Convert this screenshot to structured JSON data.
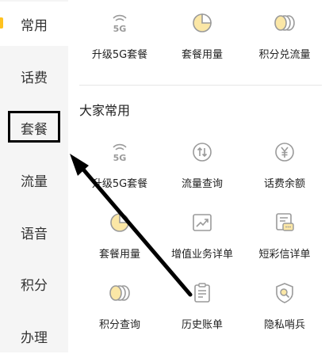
{
  "sidebar": {
    "items": [
      {
        "label": "常用"
      },
      {
        "label": "话费"
      },
      {
        "label": "套餐"
      },
      {
        "label": "流量"
      },
      {
        "label": "语音"
      },
      {
        "label": "积分"
      },
      {
        "label": "办理"
      }
    ]
  },
  "top_row": {
    "items": [
      {
        "label": "升级5G套餐",
        "icon": "5g-icon"
      },
      {
        "label": "套餐用量",
        "icon": "pie-chart-icon"
      },
      {
        "label": "积分兑流量",
        "icon": "coins-icon"
      }
    ]
  },
  "section": {
    "title": "大家常用",
    "items": [
      {
        "label": "升级5G套餐",
        "icon": "5g-icon"
      },
      {
        "label": "流量查询",
        "icon": "data-transfer-icon"
      },
      {
        "label": "话费余额",
        "icon": "yuan-icon"
      },
      {
        "label": "套餐用量",
        "icon": "pie-chart-icon"
      },
      {
        "label": "增值业务详单",
        "icon": "trend-chart-icon"
      },
      {
        "label": "短彩信详单",
        "icon": "message-icon"
      },
      {
        "label": "积分查询",
        "icon": "coins-icon"
      },
      {
        "label": "历史账单",
        "icon": "clipboard-icon"
      },
      {
        "label": "隐私哨兵",
        "icon": "privacy-shield-icon"
      }
    ]
  },
  "colors": {
    "accent": "#ffc21f",
    "icon_stroke": "#9a9a9a",
    "icon_fill": "#fbe7a6"
  }
}
